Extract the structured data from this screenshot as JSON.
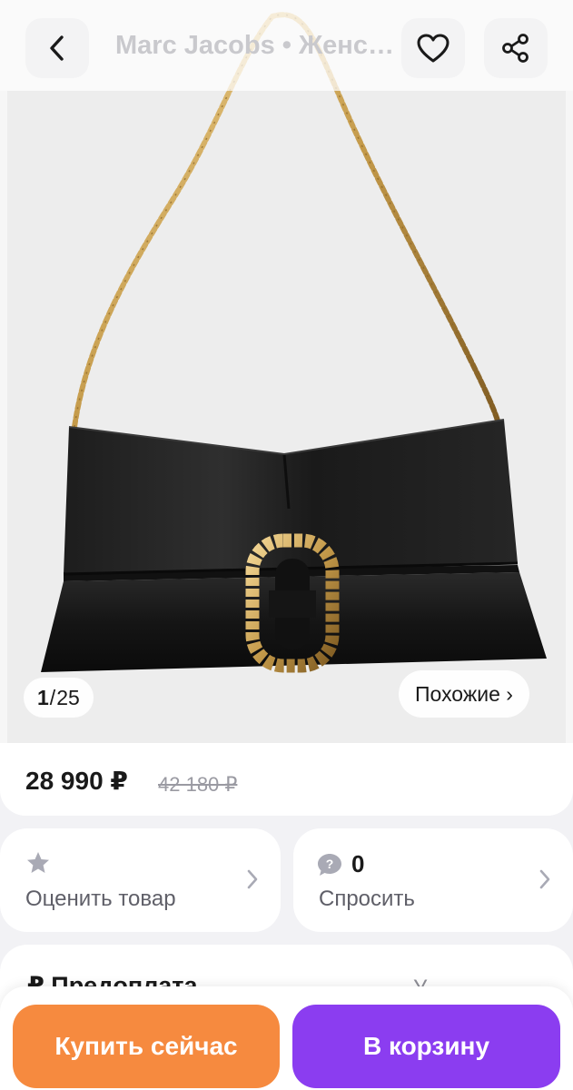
{
  "header": {
    "title": "Marc Jacobs • Женская сумка",
    "back_icon": "chevron-left-icon",
    "favorite_icon": "heart-icon",
    "share_icon": "share-icon"
  },
  "gallery": {
    "current": "1",
    "separator": "/",
    "total": "25",
    "similar_label": "Похожие ›"
  },
  "price": {
    "current": "28 990 ₽",
    "old": "42 180 ₽"
  },
  "actions": {
    "rate_label": "Оценить товар",
    "rate_icon": "star-icon",
    "ask_label": "Спросить",
    "ask_icon": "question-bubble-icon",
    "ask_count": "0"
  },
  "partial_section": {
    "label": "₽ Предоплата",
    "right_text": "У"
  },
  "bottom_bar": {
    "buy_now": "Купить сейчас",
    "add_to_cart": "В корзину"
  },
  "colors": {
    "buy": "#f68a3f",
    "cart": "#8b3df0",
    "background": "#f2f2f5"
  }
}
